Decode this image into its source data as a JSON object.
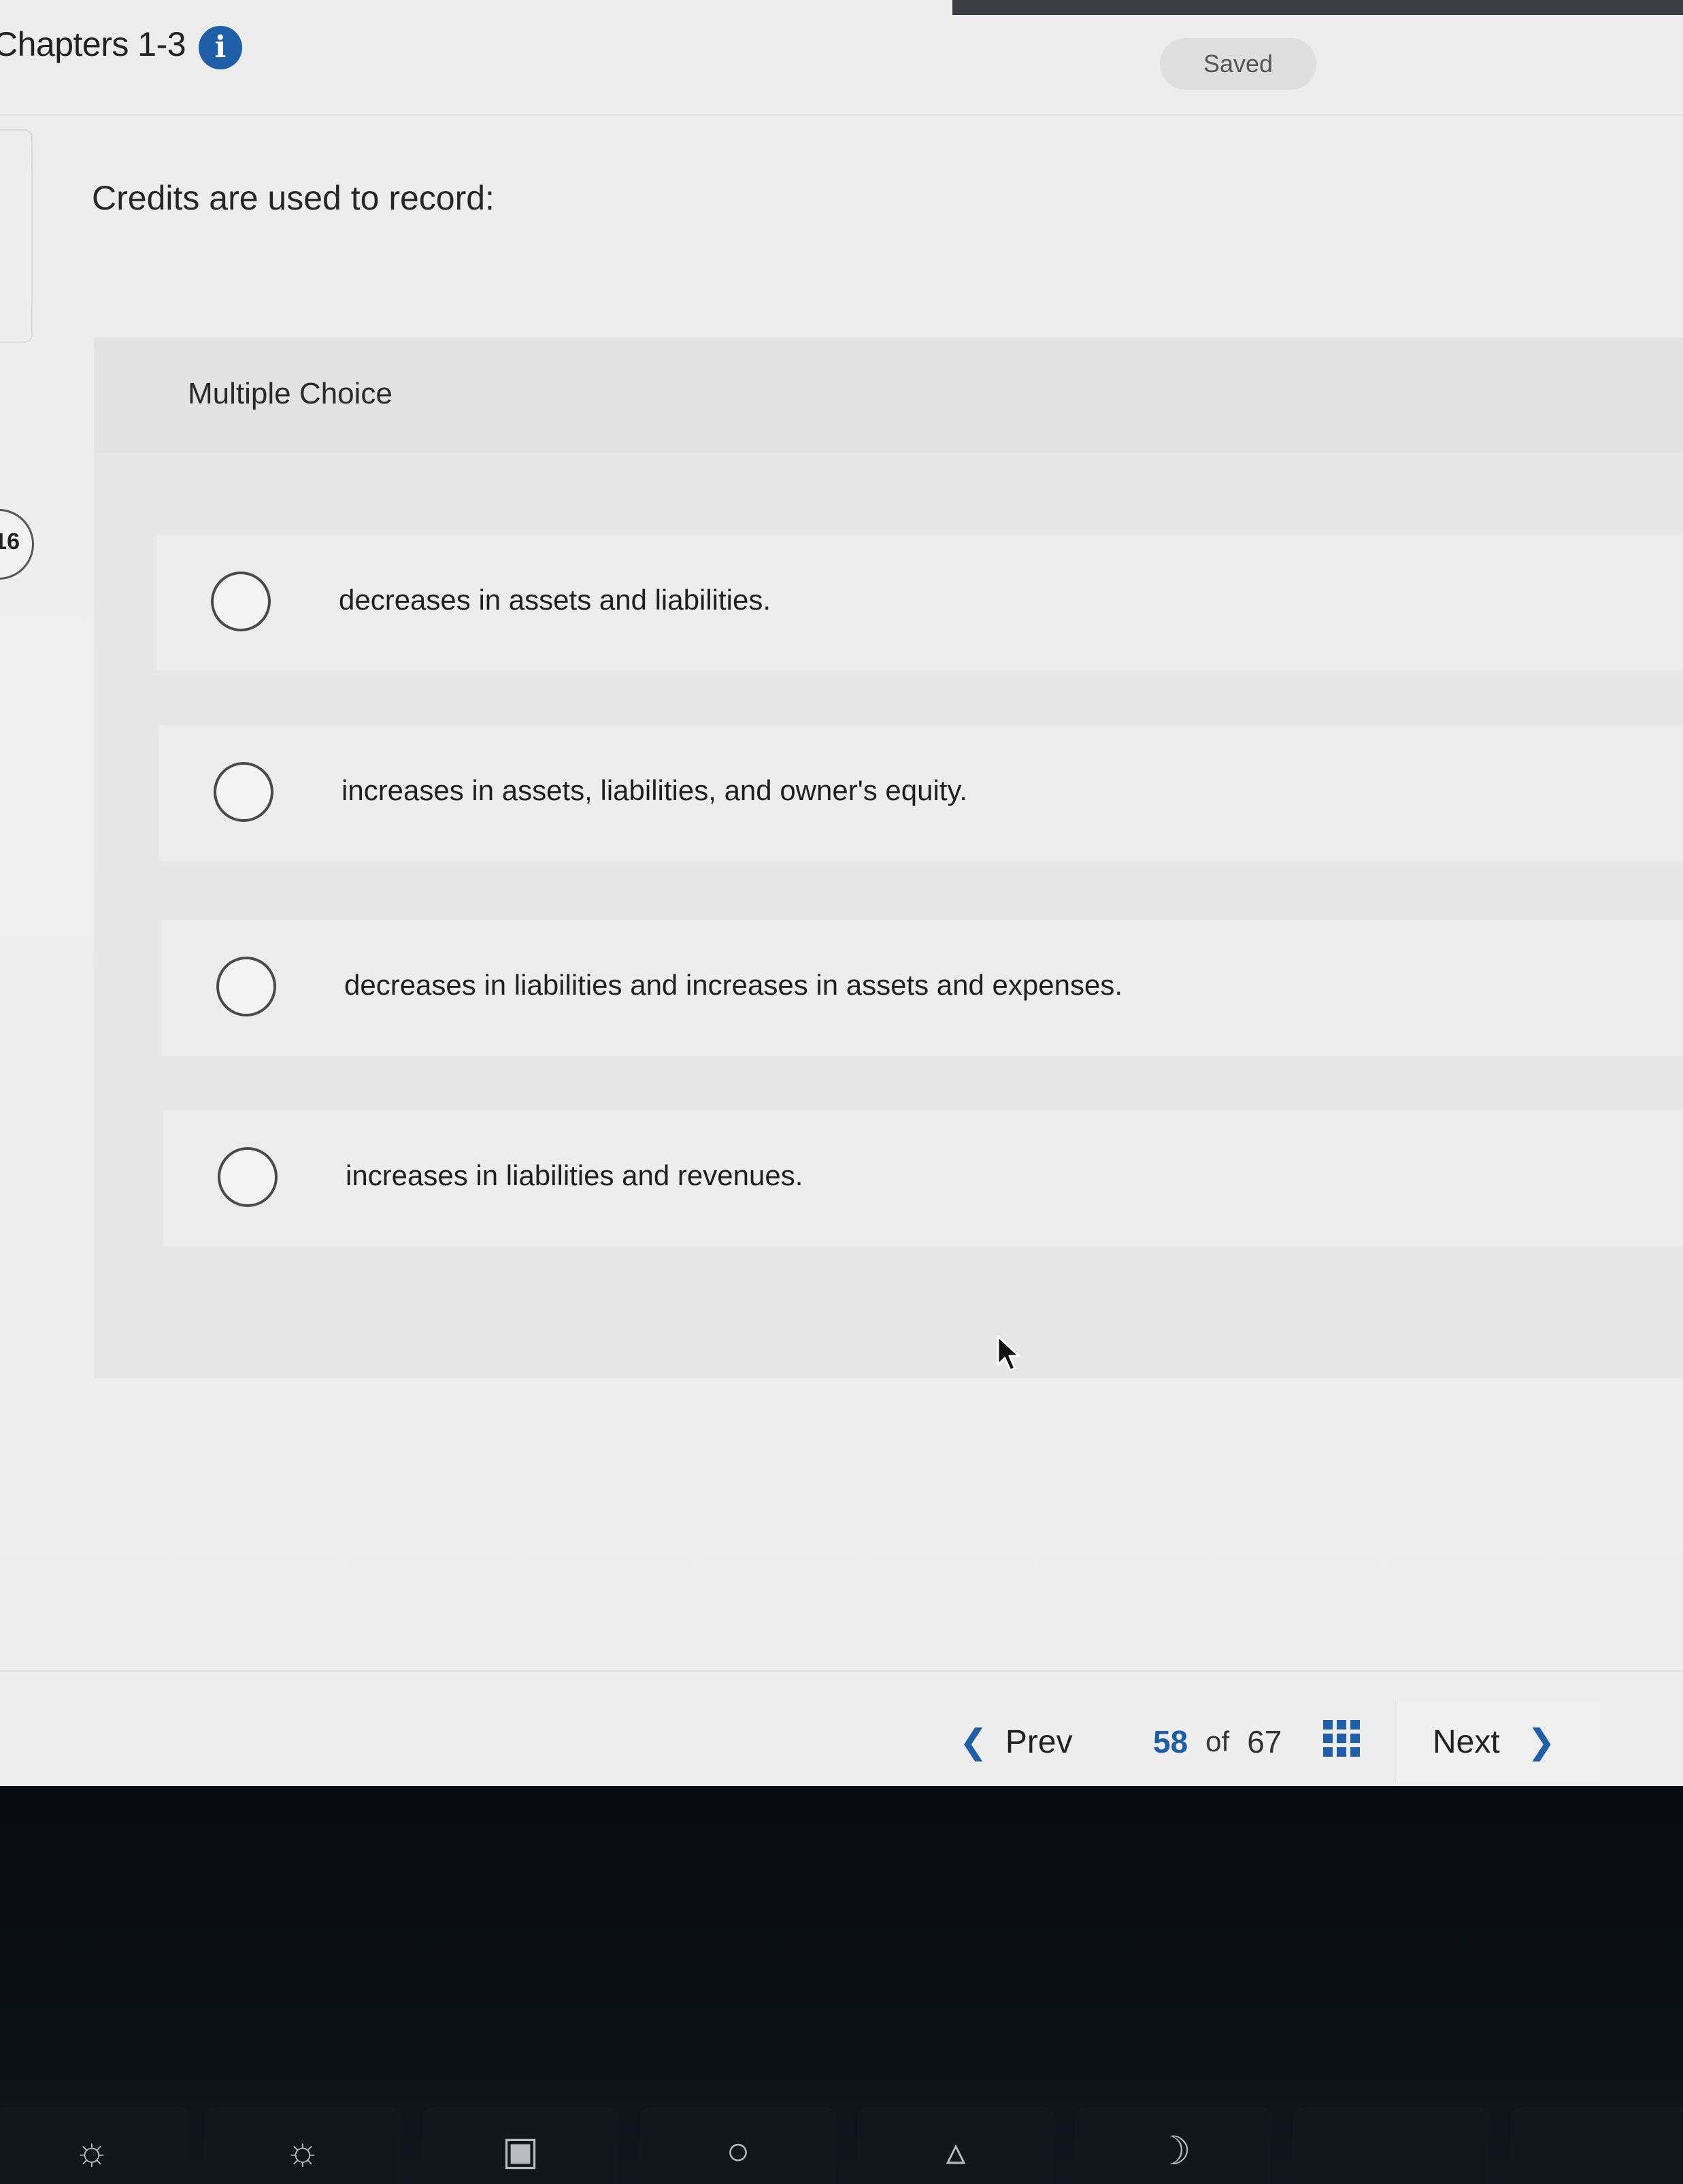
{
  "header": {
    "assignment_title": "Chapters 1-3",
    "info_icon": "i",
    "saved_label": "Saved"
  },
  "question": {
    "number": "16",
    "text": "Credits are used to record:",
    "type_label": "Multiple Choice",
    "options": [
      {
        "label": "decreases in assets and liabilities."
      },
      {
        "label": "increases in assets, liabilities, and owner's equity."
      },
      {
        "label": "decreases in liabilities and increases in assets and expenses."
      },
      {
        "label": "increases in liabilities and revenues."
      }
    ]
  },
  "footer": {
    "prev_label": "Prev",
    "current_page": "58",
    "of_label": "of",
    "total_pages": "67",
    "next_label": "Next"
  },
  "keyboard": {
    "keys": [
      "brightness-down-icon",
      "brightness-up-icon",
      "mission-control-icon",
      "search-icon",
      "microphone-icon",
      "moon-icon"
    ]
  },
  "colors": {
    "accent": "#1f5fa8",
    "page_background": "#ededed",
    "panel_background": "#e6e6e6",
    "keyboard_background": "#0c1016"
  }
}
